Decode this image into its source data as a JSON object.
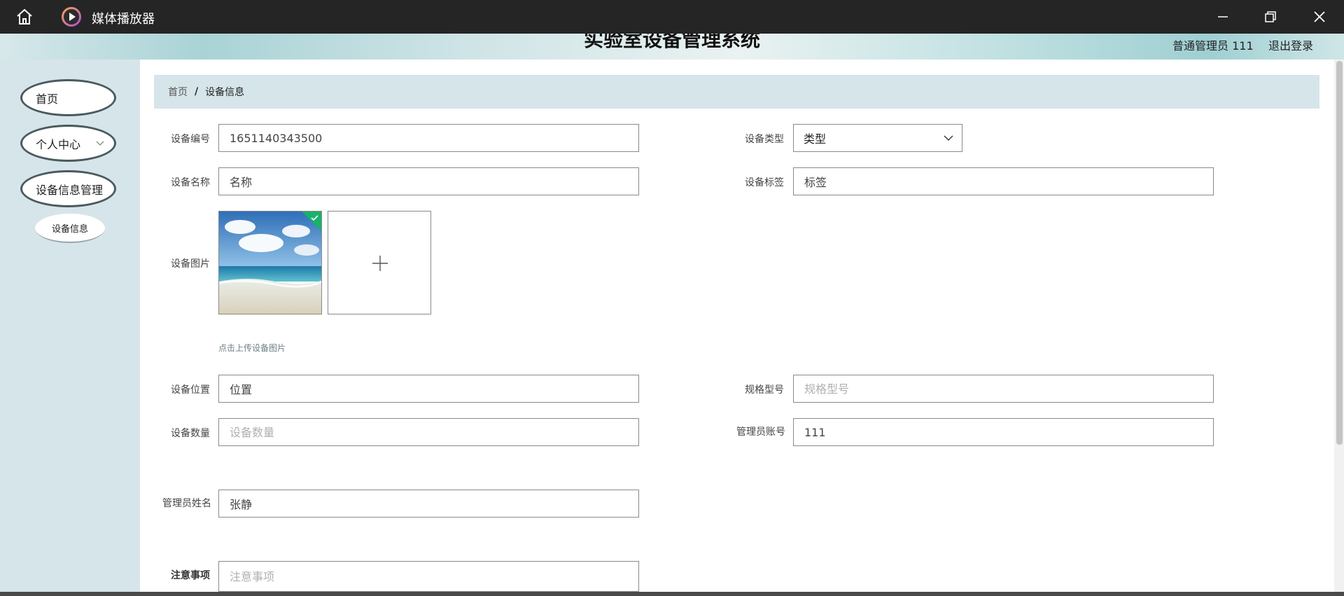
{
  "window": {
    "app_title": "媒体播放器"
  },
  "header": {
    "system_title": "实验室设备管理系统",
    "user_label": "普通管理员 111",
    "logout_label": "退出登录"
  },
  "sidebar": {
    "items": [
      {
        "label": "首页"
      },
      {
        "label": "个人中心"
      },
      {
        "label": "设备信息管理"
      }
    ],
    "sub_item": "设备信息"
  },
  "breadcrumb": {
    "home": "首页",
    "separator": "/",
    "current": "设备信息"
  },
  "form": {
    "device_no": {
      "label": "设备编号",
      "value": "1651140343500",
      "placeholder": ""
    },
    "device_type": {
      "label": "设备类型",
      "selected": "类型"
    },
    "device_name": {
      "label": "设备名称",
      "value": "名称"
    },
    "device_tag": {
      "label": "设备标签",
      "value": "标签"
    },
    "device_image": {
      "label": "设备图片",
      "hint": "点击上传设备图片"
    },
    "device_location": {
      "label": "设备位置",
      "value": "位置"
    },
    "spec_model": {
      "label": "规格型号",
      "placeholder": "规格型号"
    },
    "device_quantity": {
      "label": "设备数量",
      "placeholder": "设备数量"
    },
    "admin_account": {
      "label": "管理员账号",
      "value": "111"
    },
    "admin_name": {
      "label": "管理员姓名",
      "value": "张静"
    },
    "notes": {
      "label": "注意事项",
      "placeholder": "注意事项"
    }
  },
  "icons": {
    "home": "home-icon",
    "app": "play-circle-icon",
    "minimize": "minimize-icon",
    "maximize": "restore-icon",
    "close": "close-icon",
    "upload": "plus-icon",
    "check": "check-icon"
  }
}
